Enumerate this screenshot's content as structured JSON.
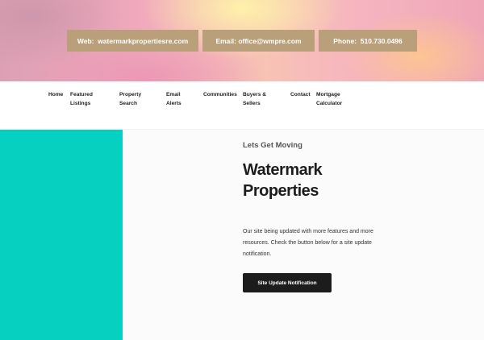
{
  "hero": {
    "web_label": "Web:  watermarkpropertiesre.com",
    "email_label": "Email: office@wmpre.com",
    "phone_label": "Phone:  510.730.0496"
  },
  "nav": {
    "items": [
      {
        "line1": "Home",
        "line2": ""
      },
      {
        "line1": "Featured",
        "line2": "Listings"
      },
      {
        "line1": "Property",
        "line2": "Search"
      },
      {
        "line1": "Email",
        "line2": "Alerts"
      },
      {
        "line1": "Communities",
        "line2": ""
      },
      {
        "line1": "Buyers &",
        "line2": "Sellers"
      },
      {
        "line1": "Contact",
        "line2": ""
      },
      {
        "line1": "Mortgage",
        "line2": "Calculator"
      }
    ]
  },
  "main": {
    "kicker": "Lets Get Moving",
    "title_line1": "Watermark",
    "title_line2": "Properties",
    "description": "Our site being updated with more features and more resources. Check the button below for a site update notification.",
    "cta_label": "Site Update Notification"
  },
  "colors": {
    "accent_gold": "#b9a07a",
    "teal_panel": "#06d1c0",
    "cta_bg": "#1c1c1c"
  }
}
